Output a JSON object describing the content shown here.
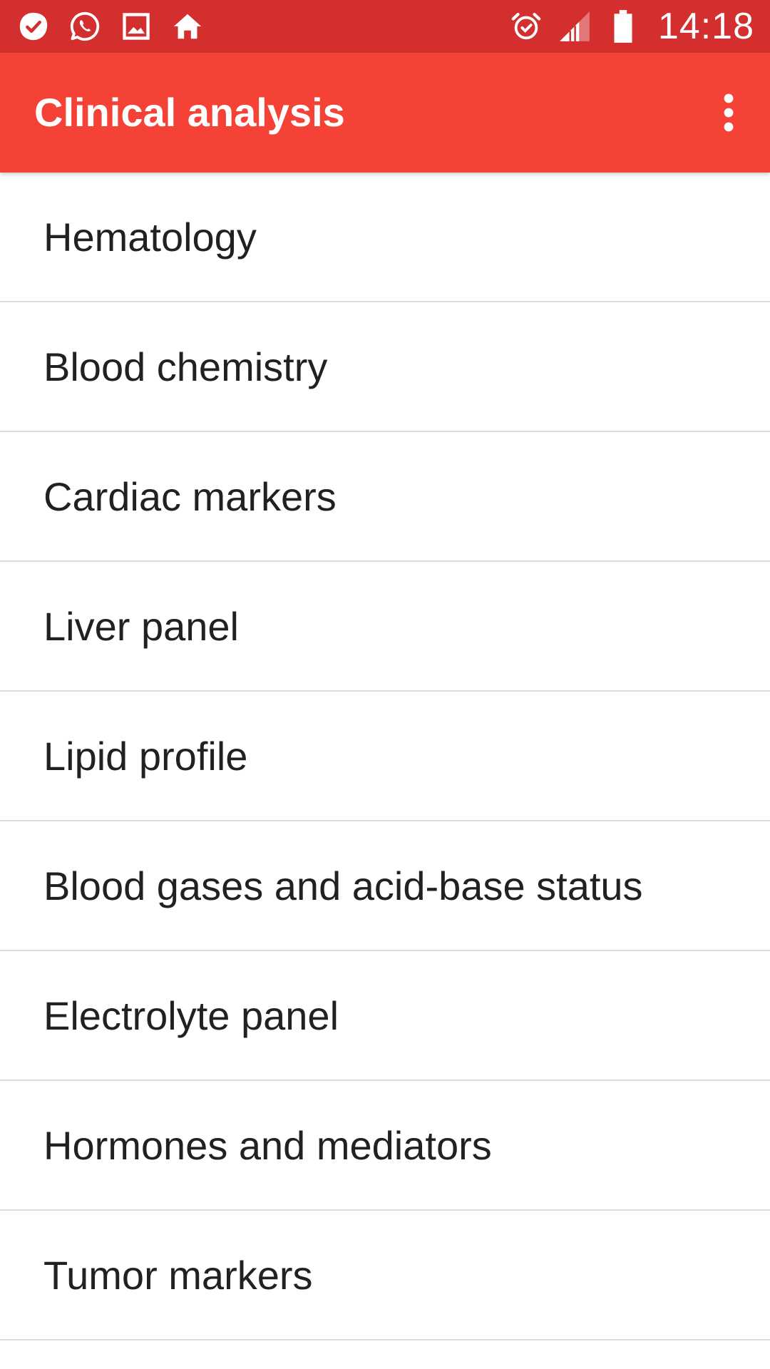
{
  "status_bar": {
    "left_icons": [
      "todo-check-icon",
      "whatsapp-icon",
      "gallery-image-icon",
      "home-icon"
    ],
    "right_icons": [
      "alarm-icon",
      "signal-icon",
      "battery-icon"
    ],
    "time": "14:18",
    "color": "#d32f2f"
  },
  "app_bar": {
    "title": "Clinical analysis",
    "overflow_icon": "more-vert-icon",
    "color": "#f44336"
  },
  "categories": {
    "items": [
      {
        "label": "Hematology"
      },
      {
        "label": "Blood chemistry"
      },
      {
        "label": "Cardiac markers"
      },
      {
        "label": "Liver panel"
      },
      {
        "label": "Lipid profile"
      },
      {
        "label": "Blood gases and acid-base status"
      },
      {
        "label": "Electrolyte panel"
      },
      {
        "label": "Hormones and mediators"
      },
      {
        "label": "Tumor markers"
      }
    ]
  }
}
